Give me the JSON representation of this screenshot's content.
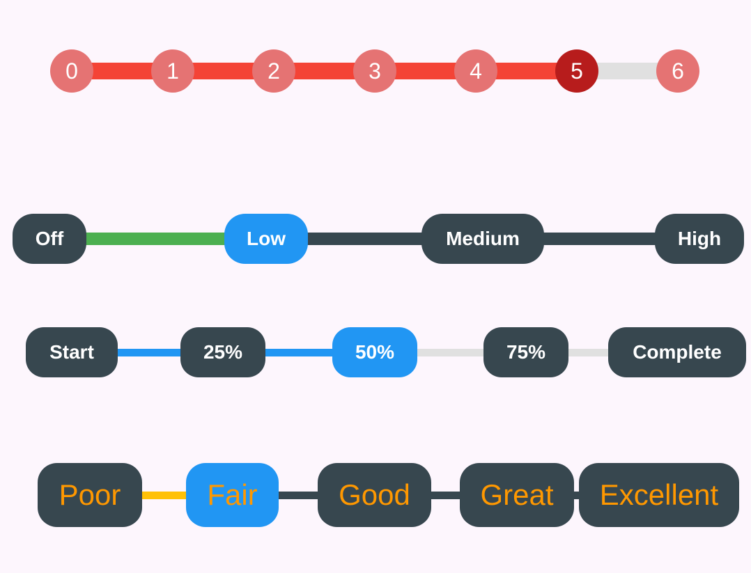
{
  "sliders": [
    {
      "id": "numeric",
      "selected_index": 5,
      "colors": {
        "active_track": "#f44336",
        "inactive_track": "#e0e0e0",
        "node": "#e57373",
        "selected_node": "#b71c1c",
        "text": "#ffffff"
      },
      "nodes": [
        {
          "label": "0"
        },
        {
          "label": "1"
        },
        {
          "label": "2"
        },
        {
          "label": "3"
        },
        {
          "label": "4"
        },
        {
          "label": "5"
        },
        {
          "label": "6"
        }
      ]
    },
    {
      "id": "level",
      "selected_index": 1,
      "colors": {
        "active_track": "#4caf50",
        "inactive_track": "#37474f",
        "node": "#37474f",
        "selected_node": "#2196f3",
        "text": "#ffffff"
      },
      "nodes": [
        {
          "label": "Off"
        },
        {
          "label": "Low"
        },
        {
          "label": "Medium"
        },
        {
          "label": "High"
        }
      ]
    },
    {
      "id": "progress",
      "selected_index": 2,
      "colors": {
        "active_track": "#2196f3",
        "inactive_track": "#e0e0e0",
        "node": "#37474f",
        "selected_node": "#2196f3",
        "text": "#ffffff"
      },
      "nodes": [
        {
          "label": "Start"
        },
        {
          "label": "25%"
        },
        {
          "label": "50%"
        },
        {
          "label": "75%"
        },
        {
          "label": "Complete"
        }
      ]
    },
    {
      "id": "rating",
      "selected_index": 1,
      "colors": {
        "active_track": "#ffc107",
        "inactive_track": "#37474f",
        "node": "#37474f",
        "selected_node": "#2196f3",
        "text": "#ff9800"
      },
      "nodes": [
        {
          "label": "Poor"
        },
        {
          "label": "Fair"
        },
        {
          "label": "Good"
        },
        {
          "label": "Great"
        },
        {
          "label": "Excellent"
        }
      ]
    }
  ]
}
